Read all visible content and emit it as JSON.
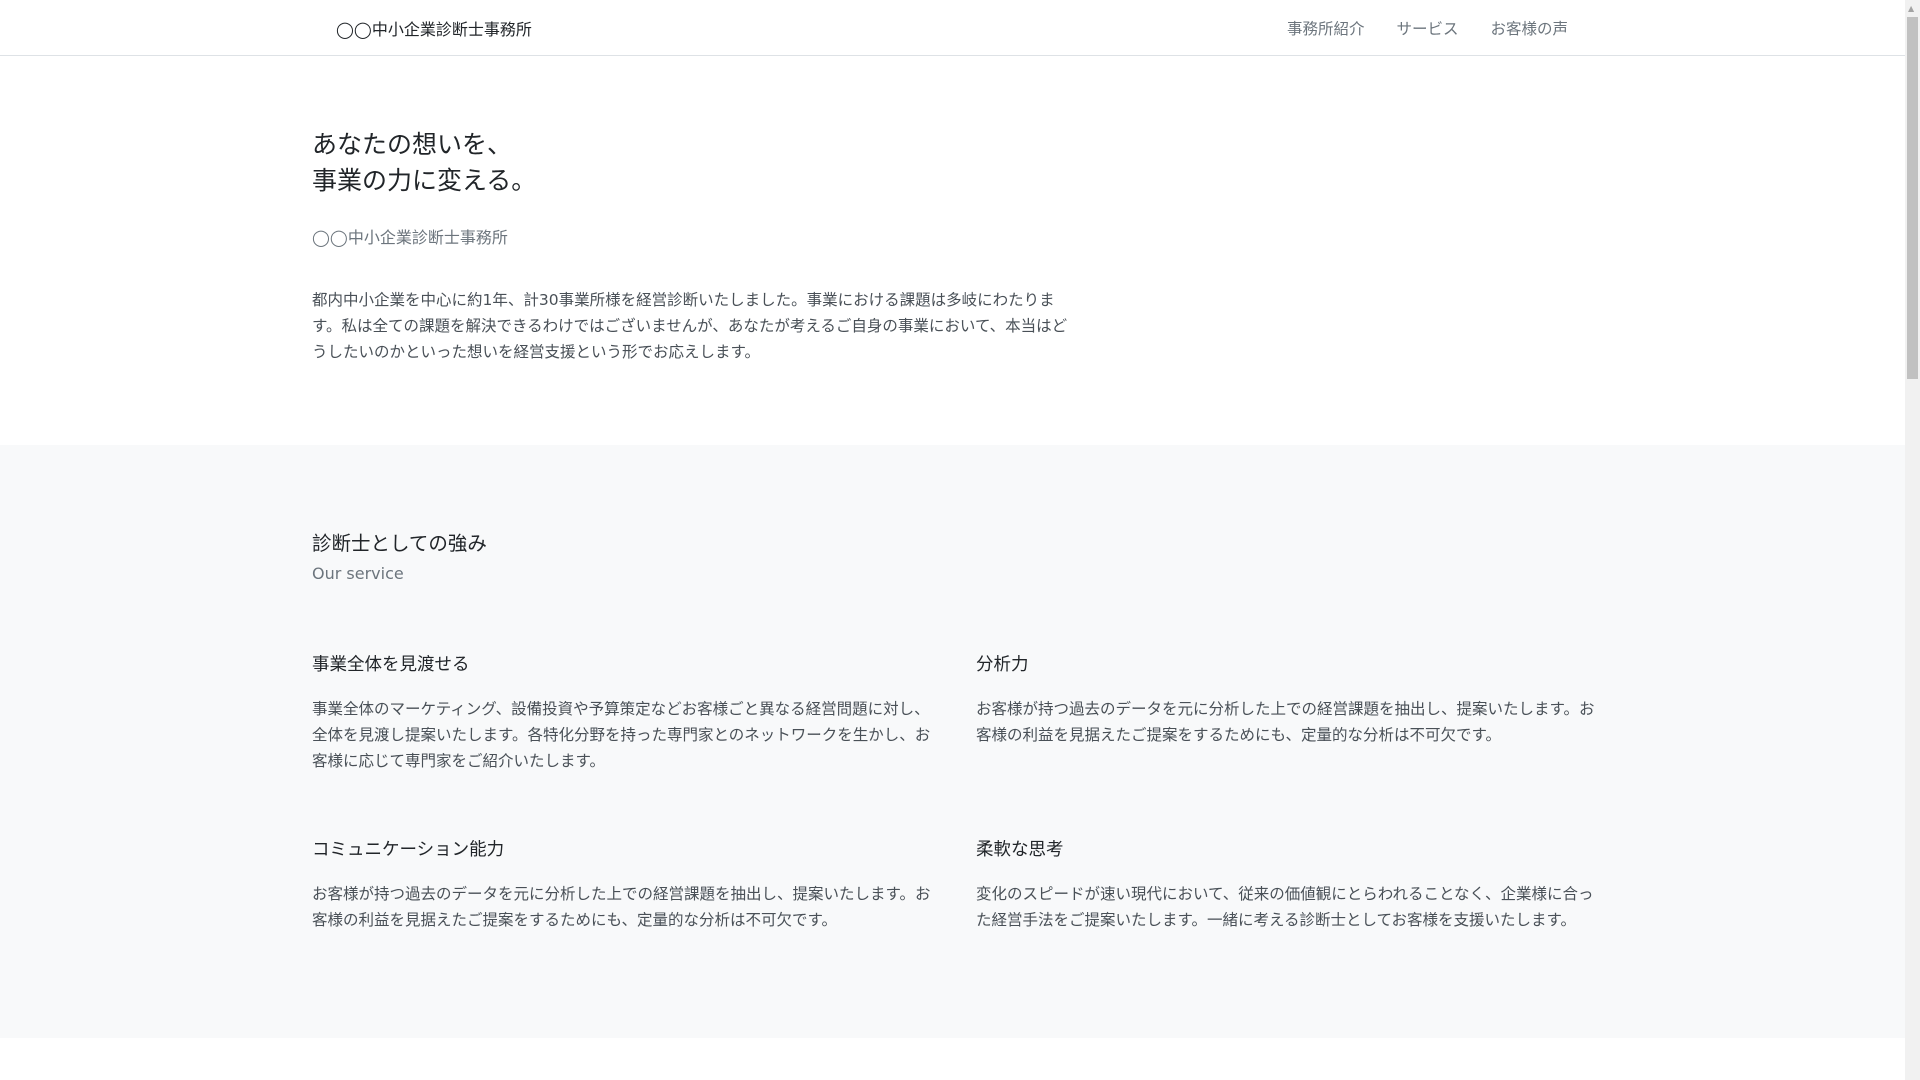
{
  "header": {
    "brand": "◯◯中小企業診断士事務所",
    "nav": [
      "事務所紹介",
      "サービス",
      "お客様の声"
    ]
  },
  "hero": {
    "title_line1": "あなたの想いを、",
    "title_line2": "事業の力に変える。",
    "subtitle": "◯◯中小企業診断士事務所",
    "text": "都内中小企業を中心に約1年、計30事業所様を経営診断いたしました。事業における課題は多岐にわたります。私は全ての課題を解決できるわけではございませんが、あなたが考えるご自身の事業において、本当はどうしたいのかといった想いを経営支援という形でお応えします。"
  },
  "strengths": {
    "title": "診断士としての強み",
    "subtitle": "Our service",
    "items": [
      {
        "title": "事業全体を見渡せる",
        "text": "事業全体のマーケティング、設備投資や予算策定などお客様ごと異なる経営問題に対し、全体を見渡し提案いたします。各特化分野を持った専門家とのネットワークを生かし、お客様に応じて専門家をご紹介いたします。"
      },
      {
        "title": "分析力",
        "text": "お客様が持つ過去のデータを元に分析した上での経営課題を抽出し、提案いたします。お客様の利益を見据えたご提案をするためにも、定量的な分析は不可欠です。"
      },
      {
        "title": "コミュニケーション能力",
        "text": "お客様が持つ過去のデータを元に分析した上での経営課題を抽出し、提案いたします。お客様の利益を見据えたご提案をするためにも、定量的な分析は不可欠です。"
      },
      {
        "title": "柔軟な思考",
        "text": "変化のスピードが速い現代において、従来の価値観にとらわれることなく、企業様に合った経営手法をご提案いたします。一緒に考える診断士としてお客様を支援いたします。"
      }
    ]
  }
}
